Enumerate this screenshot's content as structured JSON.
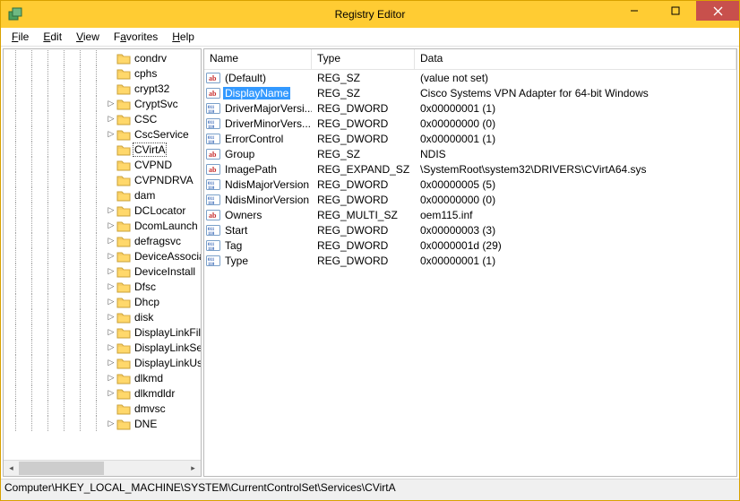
{
  "window_title": "Registry Editor",
  "menu": {
    "file": "File",
    "edit": "Edit",
    "view": "View",
    "favorites": "Favorites",
    "help": "Help"
  },
  "tree": {
    "depth": 6,
    "selected_index": 6,
    "items": [
      {
        "label": "condrv",
        "expander": ""
      },
      {
        "label": "cphs",
        "expander": ""
      },
      {
        "label": "crypt32",
        "expander": ""
      },
      {
        "label": "CryptSvc",
        "expander": "▷"
      },
      {
        "label": "CSC",
        "expander": "▷"
      },
      {
        "label": "CscService",
        "expander": "▷"
      },
      {
        "label": "CVirtA",
        "expander": ""
      },
      {
        "label": "CVPND",
        "expander": ""
      },
      {
        "label": "CVPNDRVA",
        "expander": ""
      },
      {
        "label": "dam",
        "expander": ""
      },
      {
        "label": "DCLocator",
        "expander": "▷"
      },
      {
        "label": "DcomLaunch",
        "expander": "▷"
      },
      {
        "label": "defragsvc",
        "expander": "▷"
      },
      {
        "label": "DeviceAssociationService",
        "expander": "▷"
      },
      {
        "label": "DeviceInstall",
        "expander": "▷"
      },
      {
        "label": "Dfsc",
        "expander": "▷"
      },
      {
        "label": "Dhcp",
        "expander": "▷"
      },
      {
        "label": "disk",
        "expander": "▷"
      },
      {
        "label": "DisplayLinkFilter",
        "expander": "▷"
      },
      {
        "label": "DisplayLinkService",
        "expander": "▷"
      },
      {
        "label": "DisplayLinkUsbPort",
        "expander": "▷"
      },
      {
        "label": "dlkmd",
        "expander": "▷"
      },
      {
        "label": "dlkmdldr",
        "expander": "▷"
      },
      {
        "label": "dmvsc",
        "expander": ""
      },
      {
        "label": "DNE",
        "expander": "▷"
      }
    ]
  },
  "columns": {
    "name": "Name",
    "type": "Type",
    "data": "Data"
  },
  "values": [
    {
      "icon": "str",
      "name": "(Default)",
      "type": "REG_SZ",
      "data": "(value not set)",
      "selected": false,
      "ellipsis": false
    },
    {
      "icon": "str",
      "name": "DisplayName",
      "type": "REG_SZ",
      "data": "Cisco Systems VPN Adapter for 64-bit Windows",
      "selected": true,
      "ellipsis": false
    },
    {
      "icon": "bin",
      "name": "DriverMajorVersi...",
      "type": "REG_DWORD",
      "data": "0x00000001 (1)",
      "selected": false,
      "ellipsis": true
    },
    {
      "icon": "bin",
      "name": "DriverMinorVers...",
      "type": "REG_DWORD",
      "data": "0x00000000 (0)",
      "selected": false,
      "ellipsis": true
    },
    {
      "icon": "bin",
      "name": "ErrorControl",
      "type": "REG_DWORD",
      "data": "0x00000001 (1)",
      "selected": false,
      "ellipsis": false
    },
    {
      "icon": "str",
      "name": "Group",
      "type": "REG_SZ",
      "data": "NDIS",
      "selected": false,
      "ellipsis": false
    },
    {
      "icon": "str",
      "name": "ImagePath",
      "type": "REG_EXPAND_SZ",
      "data": "\\SystemRoot\\system32\\DRIVERS\\CVirtA64.sys",
      "selected": false,
      "ellipsis": false
    },
    {
      "icon": "bin",
      "name": "NdisMajorVersion",
      "type": "REG_DWORD",
      "data": "0x00000005 (5)",
      "selected": false,
      "ellipsis": false
    },
    {
      "icon": "bin",
      "name": "NdisMinorVersion",
      "type": "REG_DWORD",
      "data": "0x00000000 (0)",
      "selected": false,
      "ellipsis": false
    },
    {
      "icon": "str",
      "name": "Owners",
      "type": "REG_MULTI_SZ",
      "data": "oem115.inf",
      "selected": false,
      "ellipsis": false
    },
    {
      "icon": "bin",
      "name": "Start",
      "type": "REG_DWORD",
      "data": "0x00000003 (3)",
      "selected": false,
      "ellipsis": false
    },
    {
      "icon": "bin",
      "name": "Tag",
      "type": "REG_DWORD",
      "data": "0x0000001d (29)",
      "selected": false,
      "ellipsis": false
    },
    {
      "icon": "bin",
      "name": "Type",
      "type": "REG_DWORD",
      "data": "0x00000001 (1)",
      "selected": false,
      "ellipsis": false
    }
  ],
  "statusbar": "Computer\\HKEY_LOCAL_MACHINE\\SYSTEM\\CurrentControlSet\\Services\\CVirtA"
}
